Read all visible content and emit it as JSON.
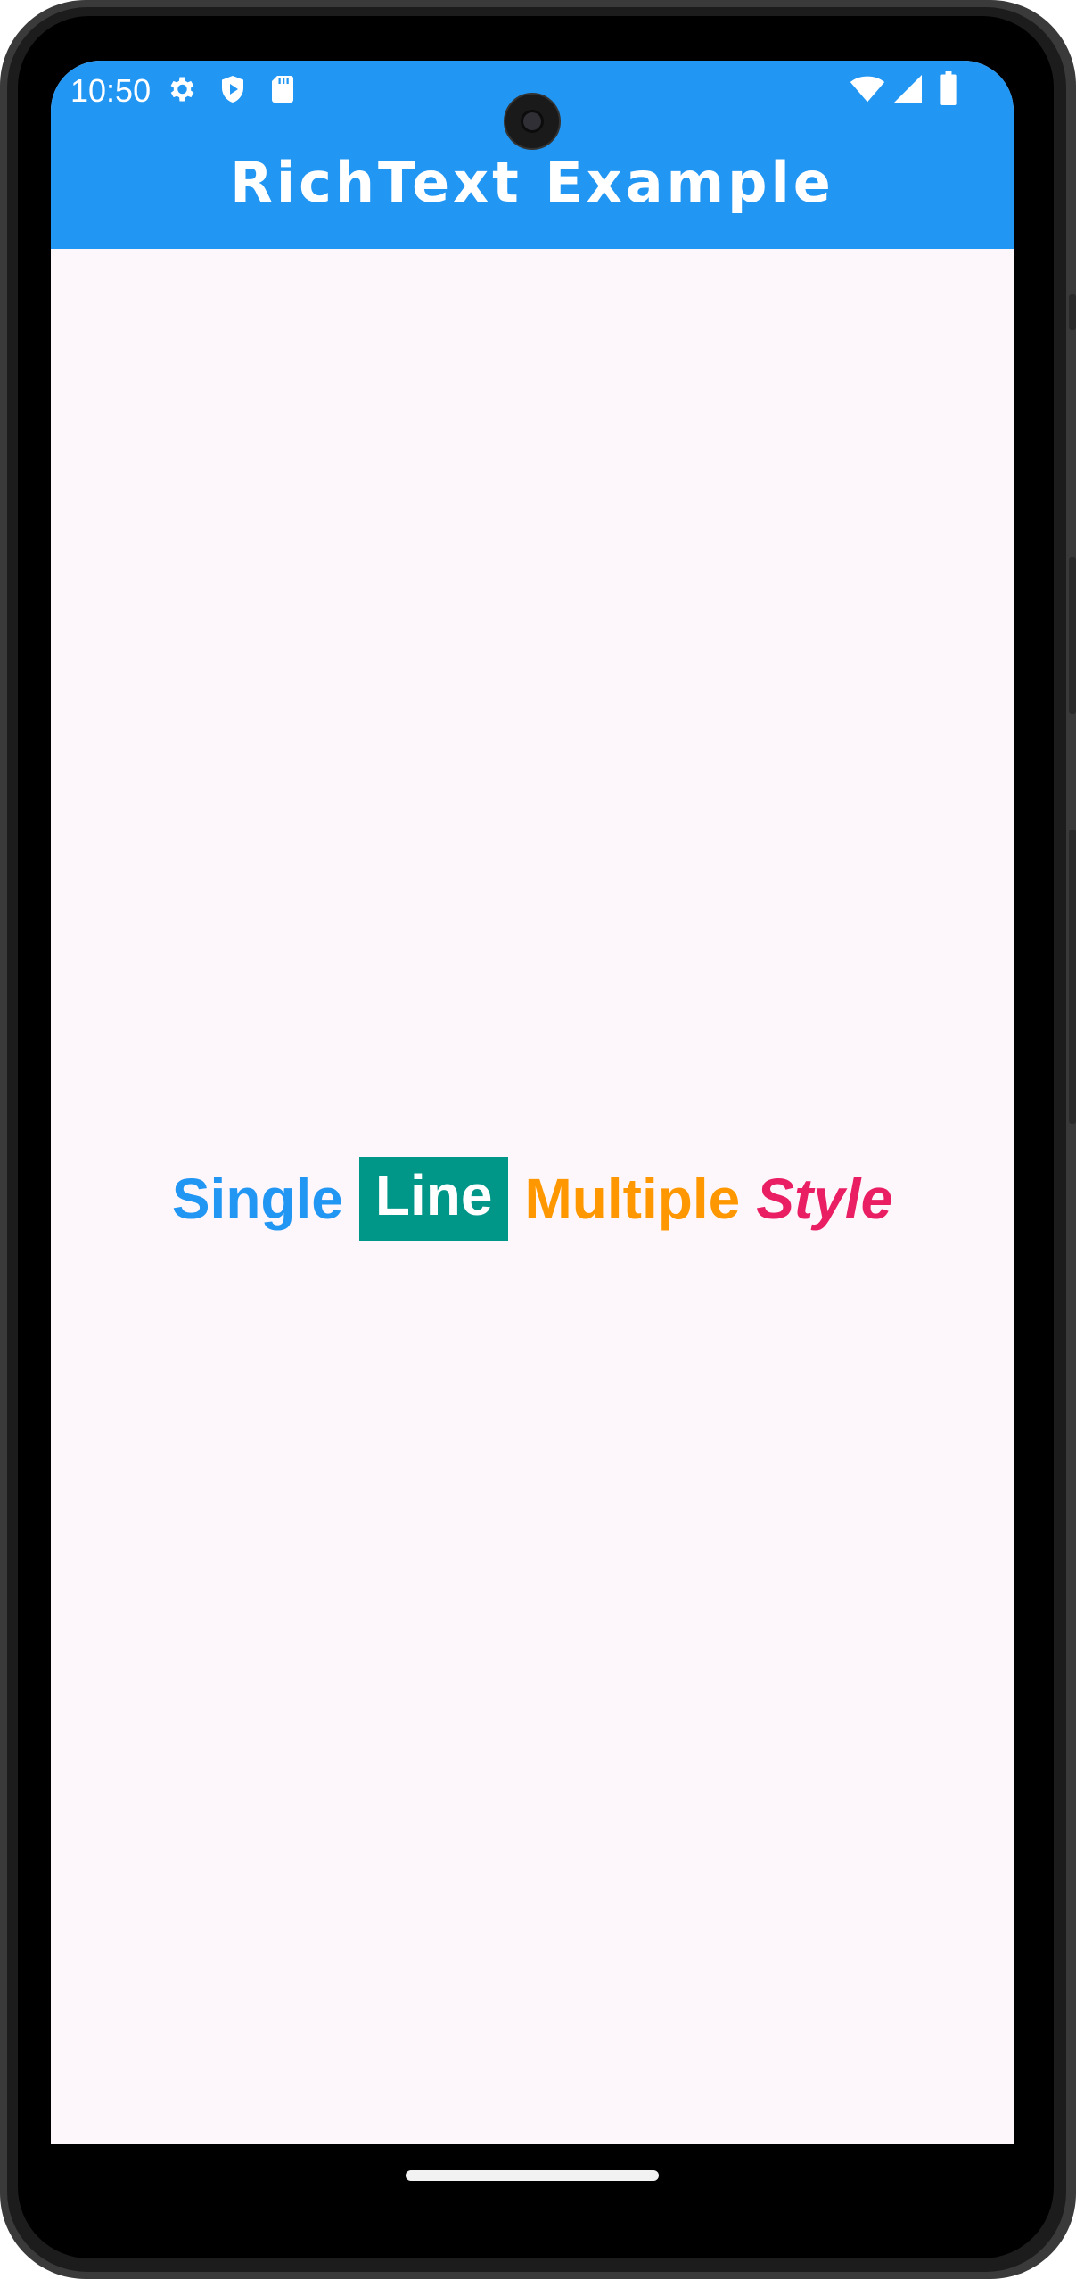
{
  "status_bar": {
    "time": "10:50",
    "left_icons": [
      "settings-icon",
      "shield-play-icon",
      "sd-card-icon"
    ],
    "right_icons": [
      "wifi-icon",
      "signal-icon",
      "battery-icon"
    ]
  },
  "app_bar": {
    "title": "RichText Example",
    "color": "#2196f3"
  },
  "rich_text": {
    "spans": [
      {
        "text": "Single",
        "color": "#2196f3"
      },
      {
        "text": "Line",
        "color": "#ffffff",
        "background": "#009688"
      },
      {
        "text": "Multiple",
        "color": "#ff9800"
      },
      {
        "text": "Style",
        "color": "#e91e63",
        "italic": true
      }
    ]
  },
  "colors": {
    "background": "#fdf7fb"
  }
}
